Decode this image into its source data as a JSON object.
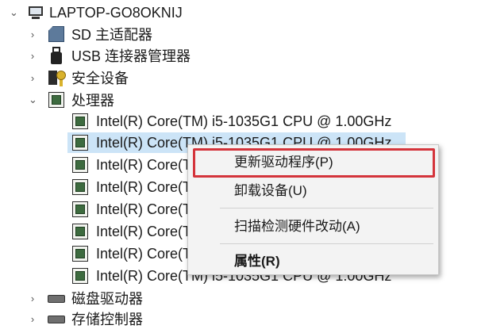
{
  "tree": {
    "root": {
      "label": "LAPTOP-GO8OKNIJ",
      "expanded": true
    },
    "categories": [
      {
        "label": "SD 主适配器",
        "icon": "sd-card-icon",
        "expanded": false
      },
      {
        "label": "USB 连接器管理器",
        "icon": "usb-icon",
        "expanded": false
      },
      {
        "label": "安全设备",
        "icon": "security-device-icon",
        "expanded": false
      },
      {
        "label": "处理器",
        "icon": "processor-icon",
        "expanded": true
      },
      {
        "label": "磁盘驱动器",
        "icon": "disk-drive-icon",
        "expanded": false
      },
      {
        "label": "存储控制器",
        "icon": "storage-controller-icon",
        "expanded": false
      }
    ],
    "processors": [
      "Intel(R) Core(TM) i5-1035G1 CPU @ 1.00GHz",
      "Intel(R) Core(TM) i5-1035G1 CPU @ 1.00GHz",
      "Intel(R) Core(TM) i5-1035G1 CPU @ 1.00GHz",
      "Intel(R) Core(TM) i5-1035G1 CPU @ 1.00GHz",
      "Intel(R) Core(TM) i5-1035G1 CPU @ 1.00GHz",
      "Intel(R) Core(TM) i5-1035G1 CPU @ 1.00GHz",
      "Intel(R) Core(TM) i5-1035G1 CPU @ 1.00GHz",
      "Intel(R) Core(TM) i5-1035G1 CPU @ 1.00GHz"
    ],
    "selected_processor_index": 1
  },
  "context_menu": {
    "items": [
      {
        "label": "更新驱动程序(P)",
        "highlighted": true
      },
      {
        "label": "卸载设备(U)"
      },
      {
        "label": "扫描检测硬件改动(A)"
      },
      {
        "label": "属性(R)",
        "bold": true
      }
    ]
  },
  "colors": {
    "selection": "#cce4f7",
    "highlight_border": "#d4343b",
    "menu_background": "#f3f3f3"
  }
}
